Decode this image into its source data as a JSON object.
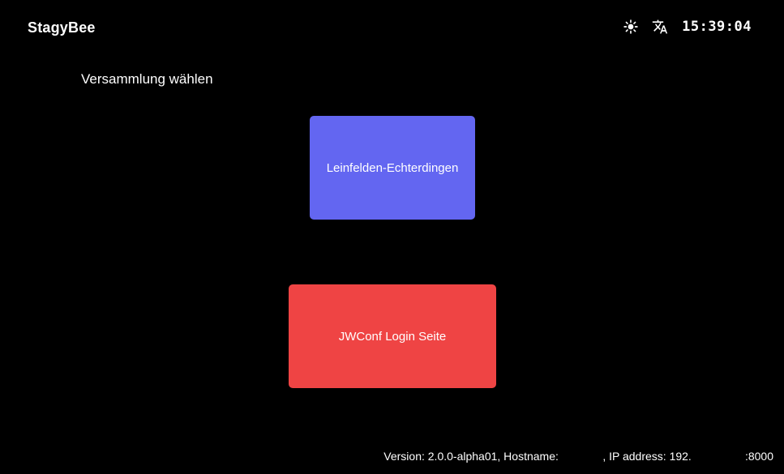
{
  "header": {
    "brand": "StagyBee",
    "clock": "15:39:04",
    "icons": {
      "theme": "sun-icon",
      "language": "translate-icon"
    }
  },
  "main": {
    "heading": "Versammlung wählen",
    "congregation_button": {
      "label": "Leinfelden-Echterdingen",
      "color": "#6366f1"
    },
    "login_button": {
      "label": "JWConf Login Seite",
      "color": "#ef4444"
    }
  },
  "footer": {
    "version_text": "Version: 2.0.0-alpha01, Hostname:",
    "ip_text": ", IP address: 192.",
    "port_text": ":8000"
  }
}
